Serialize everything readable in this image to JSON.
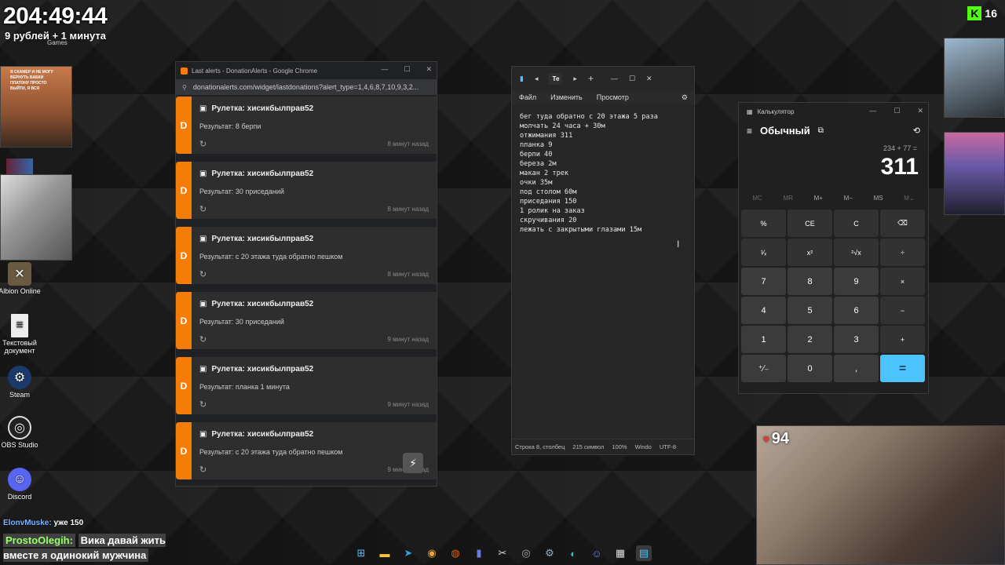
{
  "overlay": {
    "timer": "204:49:44",
    "rate": "9 рублей + 1 минута",
    "games_label": "Games",
    "donation_snippet": "Я СКАМЕР И НЕ МОГУ ВЕРНУТЬ БАБКИ ПЛАТОНУ ПРОСТО ВЫЙТИ, Я ВСЯ",
    "kick_count": "16",
    "likes": "94"
  },
  "desktop_icons": [
    {
      "label": "Albion Online",
      "icon": "albion-icon"
    },
    {
      "label": "Текстовый документ",
      "icon": "text-document-icon"
    },
    {
      "label": "Steam",
      "icon": "steam-icon"
    },
    {
      "label": "OBS Studio",
      "icon": "obs-icon"
    },
    {
      "label": "Discord",
      "icon": "discord-icon"
    }
  ],
  "chrome": {
    "title": "Last alerts - DonationAlerts - Google Chrome",
    "url": "donationalerts.com/widget/lastdonations?alert_type=1,4,6,8,7,10,9,3,2...",
    "alerts": [
      {
        "title": "Рулетка: хисикбылправ52",
        "result": "Результат: 8 берпи",
        "time": "8 минут назад"
      },
      {
        "title": "Рулетка: хисикбылправ52",
        "result": "Результат: 30 приседаний",
        "time": "8 минут назад"
      },
      {
        "title": "Рулетка: хисикбылправ52",
        "result": "Результат: с 20 этажа туда обратно пешком",
        "time": "8 минут назад"
      },
      {
        "title": "Рулетка: хисикбылправ52",
        "result": "Результат: 30 приседаний",
        "time": "9 минут назад"
      },
      {
        "title": "Рулетка: хисикбылправ52",
        "result": "Результат: планка 1 минута",
        "time": "9 минут назад"
      },
      {
        "title": "Рулетка: хисикбылправ52",
        "result": "Результат: с 20 этажа туда обратно пешком",
        "time": "9 минут назад"
      }
    ]
  },
  "notepad": {
    "tab": "Те",
    "menu": [
      "Файл",
      "Изменить",
      "Просмотр"
    ],
    "lines": [
      "бег туда обратно с 20 этажа 5 раза",
      "молчать 24 часа + 30м",
      "отжимания 311",
      "планка 9",
      "берпи 40",
      "береза 2м",
      "макан 2 трек",
      "очки 35м",
      "под столом 60м",
      "приседания 150",
      "1 ролик на заказ",
      "скручивания 20",
      "лежать с закрытыми глазами 15м"
    ],
    "status": {
      "position": "Строка 8, столбец",
      "chars": "215 символ",
      "zoom": "100%",
      "eol": "Windo",
      "encoding": "UTF-8"
    }
  },
  "calculator": {
    "title": "Калькулятор",
    "mode": "Обычный",
    "expression": "234 + 77 =",
    "value": "311",
    "memory": [
      "MC",
      "MR",
      "M+",
      "M−",
      "MS",
      "M⌄"
    ],
    "keys": [
      "%",
      "CE",
      "C",
      "⌫",
      "¹⁄ₓ",
      "x²",
      "²√x",
      "÷",
      "7",
      "8",
      "9",
      "×",
      "4",
      "5",
      "6",
      "−",
      "1",
      "2",
      "3",
      "+",
      "⁺∕₋",
      "0",
      ",",
      "="
    ]
  },
  "chat": {
    "line1_user": "ElonvMuske:",
    "line1_text": "уже 150",
    "line2_user": "ProstoOlegih:",
    "line2_text": "Вика давай жить вместе я одинокий мужчина"
  }
}
